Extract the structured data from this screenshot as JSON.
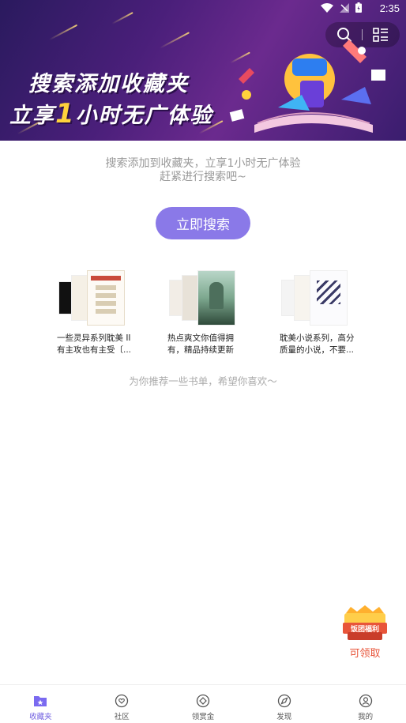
{
  "status_bar": {
    "time": "2:35"
  },
  "banner": {
    "line1": "搜索添加收藏夹",
    "line2_prefix": "立享",
    "line2_highlight": "1",
    "line2_suffix": "小时无广体验"
  },
  "intro": {
    "line1": "搜索添加到收藏夹，立享1小时无广体验",
    "line2": "赶紧进行搜索吧~"
  },
  "search_button": "立即搜索",
  "book_lists": [
    {
      "desc": "一些灵异系列耽美 II 有主攻也有主受〔..."
    },
    {
      "desc": "热点爽文你值得拥有，精品持续更新"
    },
    {
      "desc": "耽美小说系列，高分质量的小说，不要..."
    }
  ],
  "recommend_tip": "为你推荐一些书单，希望你喜欢～",
  "reward": {
    "badge": "饭团福利",
    "label": "可领取"
  },
  "bottom_nav": [
    {
      "label": "收藏夹",
      "active": true
    },
    {
      "label": "社区"
    },
    {
      "label": "领赏金"
    },
    {
      "label": "发现"
    },
    {
      "label": "我的"
    }
  ],
  "colors": {
    "accent": "#8a79e8",
    "nav_active": "#6f5ee0",
    "reward": "#e8553a"
  }
}
